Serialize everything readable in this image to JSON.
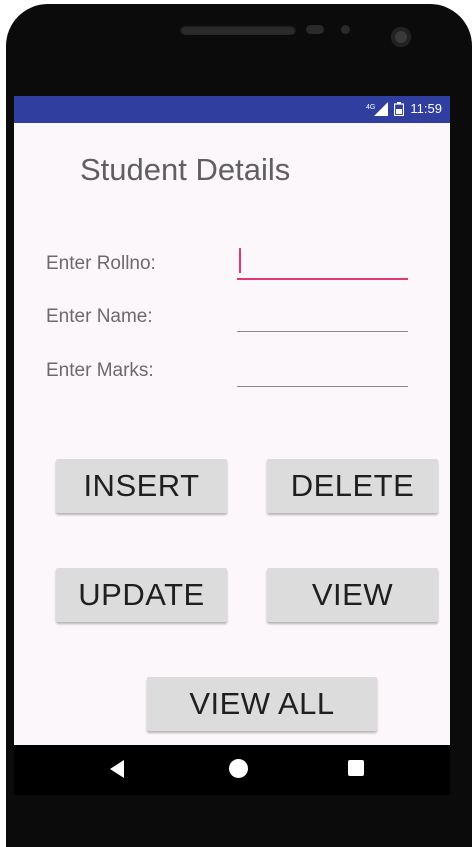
{
  "status_bar": {
    "time": "11:59",
    "network": "4G",
    "color": "#303f9f"
  },
  "app": {
    "title": "Student Details"
  },
  "form": {
    "rollno_label": "Enter Rollno:",
    "rollno_value": "",
    "name_label": "Enter Name:",
    "name_value": "",
    "marks_label": "Enter Marks:",
    "marks_value": ""
  },
  "buttons": {
    "insert": "INSERT",
    "delete": "DELETE",
    "update": "UPDATE",
    "view": "VIEW",
    "view_all": "VIEW ALL"
  },
  "colors": {
    "accent": "#e0377a",
    "button": "#dcdcdc",
    "background": "#fcf7fb"
  },
  "nav": {
    "back_icon": "back-triangle-icon",
    "home_icon": "home-circle-icon",
    "recent_icon": "recent-square-icon"
  }
}
